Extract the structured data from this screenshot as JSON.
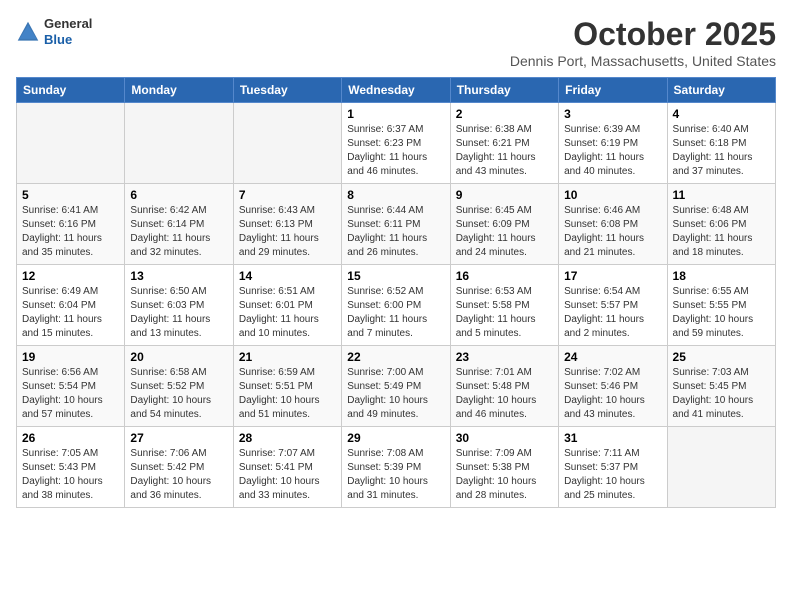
{
  "header": {
    "logo_general": "General",
    "logo_blue": "Blue",
    "title": "October 2025",
    "subtitle": "Dennis Port, Massachusetts, United States"
  },
  "weekdays": [
    "Sunday",
    "Monday",
    "Tuesday",
    "Wednesday",
    "Thursday",
    "Friday",
    "Saturday"
  ],
  "weeks": [
    [
      {
        "day": "",
        "info": ""
      },
      {
        "day": "",
        "info": ""
      },
      {
        "day": "",
        "info": ""
      },
      {
        "day": "1",
        "info": "Sunrise: 6:37 AM\nSunset: 6:23 PM\nDaylight: 11 hours and 46 minutes."
      },
      {
        "day": "2",
        "info": "Sunrise: 6:38 AM\nSunset: 6:21 PM\nDaylight: 11 hours and 43 minutes."
      },
      {
        "day": "3",
        "info": "Sunrise: 6:39 AM\nSunset: 6:19 PM\nDaylight: 11 hours and 40 minutes."
      },
      {
        "day": "4",
        "info": "Sunrise: 6:40 AM\nSunset: 6:18 PM\nDaylight: 11 hours and 37 minutes."
      }
    ],
    [
      {
        "day": "5",
        "info": "Sunrise: 6:41 AM\nSunset: 6:16 PM\nDaylight: 11 hours and 35 minutes."
      },
      {
        "day": "6",
        "info": "Sunrise: 6:42 AM\nSunset: 6:14 PM\nDaylight: 11 hours and 32 minutes."
      },
      {
        "day": "7",
        "info": "Sunrise: 6:43 AM\nSunset: 6:13 PM\nDaylight: 11 hours and 29 minutes."
      },
      {
        "day": "8",
        "info": "Sunrise: 6:44 AM\nSunset: 6:11 PM\nDaylight: 11 hours and 26 minutes."
      },
      {
        "day": "9",
        "info": "Sunrise: 6:45 AM\nSunset: 6:09 PM\nDaylight: 11 hours and 24 minutes."
      },
      {
        "day": "10",
        "info": "Sunrise: 6:46 AM\nSunset: 6:08 PM\nDaylight: 11 hours and 21 minutes."
      },
      {
        "day": "11",
        "info": "Sunrise: 6:48 AM\nSunset: 6:06 PM\nDaylight: 11 hours and 18 minutes."
      }
    ],
    [
      {
        "day": "12",
        "info": "Sunrise: 6:49 AM\nSunset: 6:04 PM\nDaylight: 11 hours and 15 minutes."
      },
      {
        "day": "13",
        "info": "Sunrise: 6:50 AM\nSunset: 6:03 PM\nDaylight: 11 hours and 13 minutes."
      },
      {
        "day": "14",
        "info": "Sunrise: 6:51 AM\nSunset: 6:01 PM\nDaylight: 11 hours and 10 minutes."
      },
      {
        "day": "15",
        "info": "Sunrise: 6:52 AM\nSunset: 6:00 PM\nDaylight: 11 hours and 7 minutes."
      },
      {
        "day": "16",
        "info": "Sunrise: 6:53 AM\nSunset: 5:58 PM\nDaylight: 11 hours and 5 minutes."
      },
      {
        "day": "17",
        "info": "Sunrise: 6:54 AM\nSunset: 5:57 PM\nDaylight: 11 hours and 2 minutes."
      },
      {
        "day": "18",
        "info": "Sunrise: 6:55 AM\nSunset: 5:55 PM\nDaylight: 10 hours and 59 minutes."
      }
    ],
    [
      {
        "day": "19",
        "info": "Sunrise: 6:56 AM\nSunset: 5:54 PM\nDaylight: 10 hours and 57 minutes."
      },
      {
        "day": "20",
        "info": "Sunrise: 6:58 AM\nSunset: 5:52 PM\nDaylight: 10 hours and 54 minutes."
      },
      {
        "day": "21",
        "info": "Sunrise: 6:59 AM\nSunset: 5:51 PM\nDaylight: 10 hours and 51 minutes."
      },
      {
        "day": "22",
        "info": "Sunrise: 7:00 AM\nSunset: 5:49 PM\nDaylight: 10 hours and 49 minutes."
      },
      {
        "day": "23",
        "info": "Sunrise: 7:01 AM\nSunset: 5:48 PM\nDaylight: 10 hours and 46 minutes."
      },
      {
        "day": "24",
        "info": "Sunrise: 7:02 AM\nSunset: 5:46 PM\nDaylight: 10 hours and 43 minutes."
      },
      {
        "day": "25",
        "info": "Sunrise: 7:03 AM\nSunset: 5:45 PM\nDaylight: 10 hours and 41 minutes."
      }
    ],
    [
      {
        "day": "26",
        "info": "Sunrise: 7:05 AM\nSunset: 5:43 PM\nDaylight: 10 hours and 38 minutes."
      },
      {
        "day": "27",
        "info": "Sunrise: 7:06 AM\nSunset: 5:42 PM\nDaylight: 10 hours and 36 minutes."
      },
      {
        "day": "28",
        "info": "Sunrise: 7:07 AM\nSunset: 5:41 PM\nDaylight: 10 hours and 33 minutes."
      },
      {
        "day": "29",
        "info": "Sunrise: 7:08 AM\nSunset: 5:39 PM\nDaylight: 10 hours and 31 minutes."
      },
      {
        "day": "30",
        "info": "Sunrise: 7:09 AM\nSunset: 5:38 PM\nDaylight: 10 hours and 28 minutes."
      },
      {
        "day": "31",
        "info": "Sunrise: 7:11 AM\nSunset: 5:37 PM\nDaylight: 10 hours and 25 minutes."
      },
      {
        "day": "",
        "info": ""
      }
    ]
  ]
}
